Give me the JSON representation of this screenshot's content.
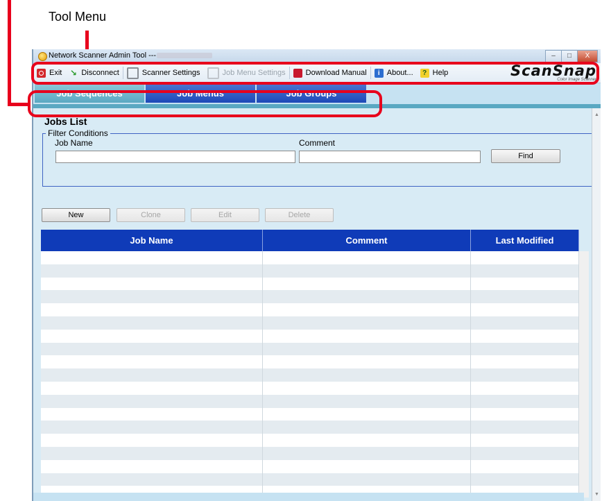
{
  "annotation": {
    "tool_menu_label": "Tool Menu"
  },
  "window": {
    "title": "Network Scanner Admin Tool ---",
    "controls": {
      "minimize": "–",
      "maximize": "□",
      "close": "X"
    }
  },
  "toolbar": {
    "items": [
      {
        "label": "Exit",
        "icon": "exit-icon",
        "enabled": true
      },
      {
        "label": "Disconnect",
        "icon": "disconnect-icon",
        "enabled": true
      },
      {
        "label": "Scanner Settings",
        "icon": "gear-icon",
        "enabled": true
      },
      {
        "label": "Job Menu Settings",
        "icon": "gear-icon",
        "enabled": false
      },
      {
        "label": "Download Manual",
        "icon": "pdf-icon",
        "enabled": true
      },
      {
        "label": "About...",
        "icon": "info-icon",
        "enabled": true
      },
      {
        "label": "Help",
        "icon": "help-icon",
        "enabled": true
      }
    ],
    "logo": {
      "brand": "ScanSnap",
      "tagline": "Color Image Scanner"
    }
  },
  "tabs": [
    {
      "label": "Job Sequences",
      "active": true
    },
    {
      "label": "Job Menus",
      "active": false
    },
    {
      "label": "Job Groups",
      "active": false
    }
  ],
  "jobs_list": {
    "title": "Jobs List",
    "filter": {
      "legend": "Filter Conditions",
      "job_name_label": "Job Name",
      "job_name_value": "",
      "comment_label": "Comment",
      "comment_value": "",
      "find_button": "Find"
    },
    "actions": [
      {
        "label": "New",
        "enabled": true
      },
      {
        "label": "Clone",
        "enabled": false
      },
      {
        "label": "Edit",
        "enabled": false
      },
      {
        "label": "Delete",
        "enabled": false
      }
    ],
    "table": {
      "columns": [
        "Job Name",
        "Comment",
        "Last Modified"
      ],
      "rows": []
    }
  },
  "colors": {
    "annotation_red": "#e8001c",
    "tab_active": "#5aa8c2",
    "tab_inactive": "#1d49b8",
    "table_header": "#0f3bb8"
  }
}
